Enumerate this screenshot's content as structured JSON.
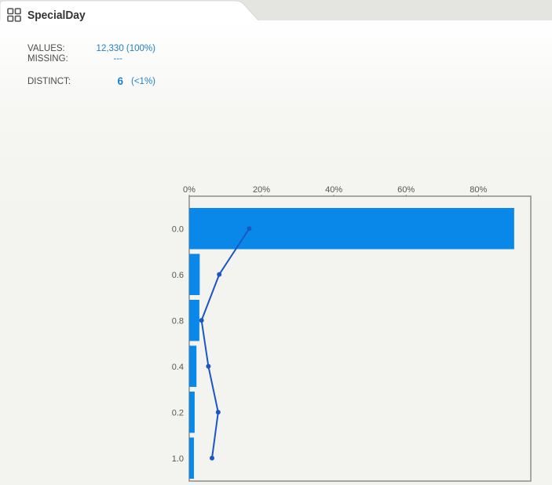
{
  "header": {
    "title": "SpecialDay",
    "icon": "grid-icon"
  },
  "stats": {
    "values_label": "VALUES:",
    "values_value": "12,330 (100%)",
    "missing_label": "MISSING:",
    "missing_value": "---",
    "distinct_label": "DISTINCT:",
    "distinct_count": "6",
    "distinct_pct": "(<1%)"
  },
  "colors": {
    "bar": "#0a88ea",
    "line": "#1a56c4",
    "accent_text": "#1e7fc8"
  },
  "chart_data": {
    "type": "bar",
    "orientation": "horizontal",
    "categories": [
      "0.0",
      "0.6",
      "0.8",
      "0.4",
      "0.2",
      "1.0"
    ],
    "values": [
      89.9,
      2.9,
      2.8,
      2.0,
      1.5,
      1.3
    ],
    "line_values": [
      16.6,
      8.3,
      3.4,
      5.3,
      8.0,
      6.3
    ],
    "xticks": [
      "0%",
      "20%",
      "40%",
      "60%",
      "80%"
    ],
    "xtick_values": [
      0,
      20,
      40,
      60,
      80
    ],
    "xlim": [
      0,
      94.5
    ],
    "unit": "percent",
    "grid": false
  }
}
